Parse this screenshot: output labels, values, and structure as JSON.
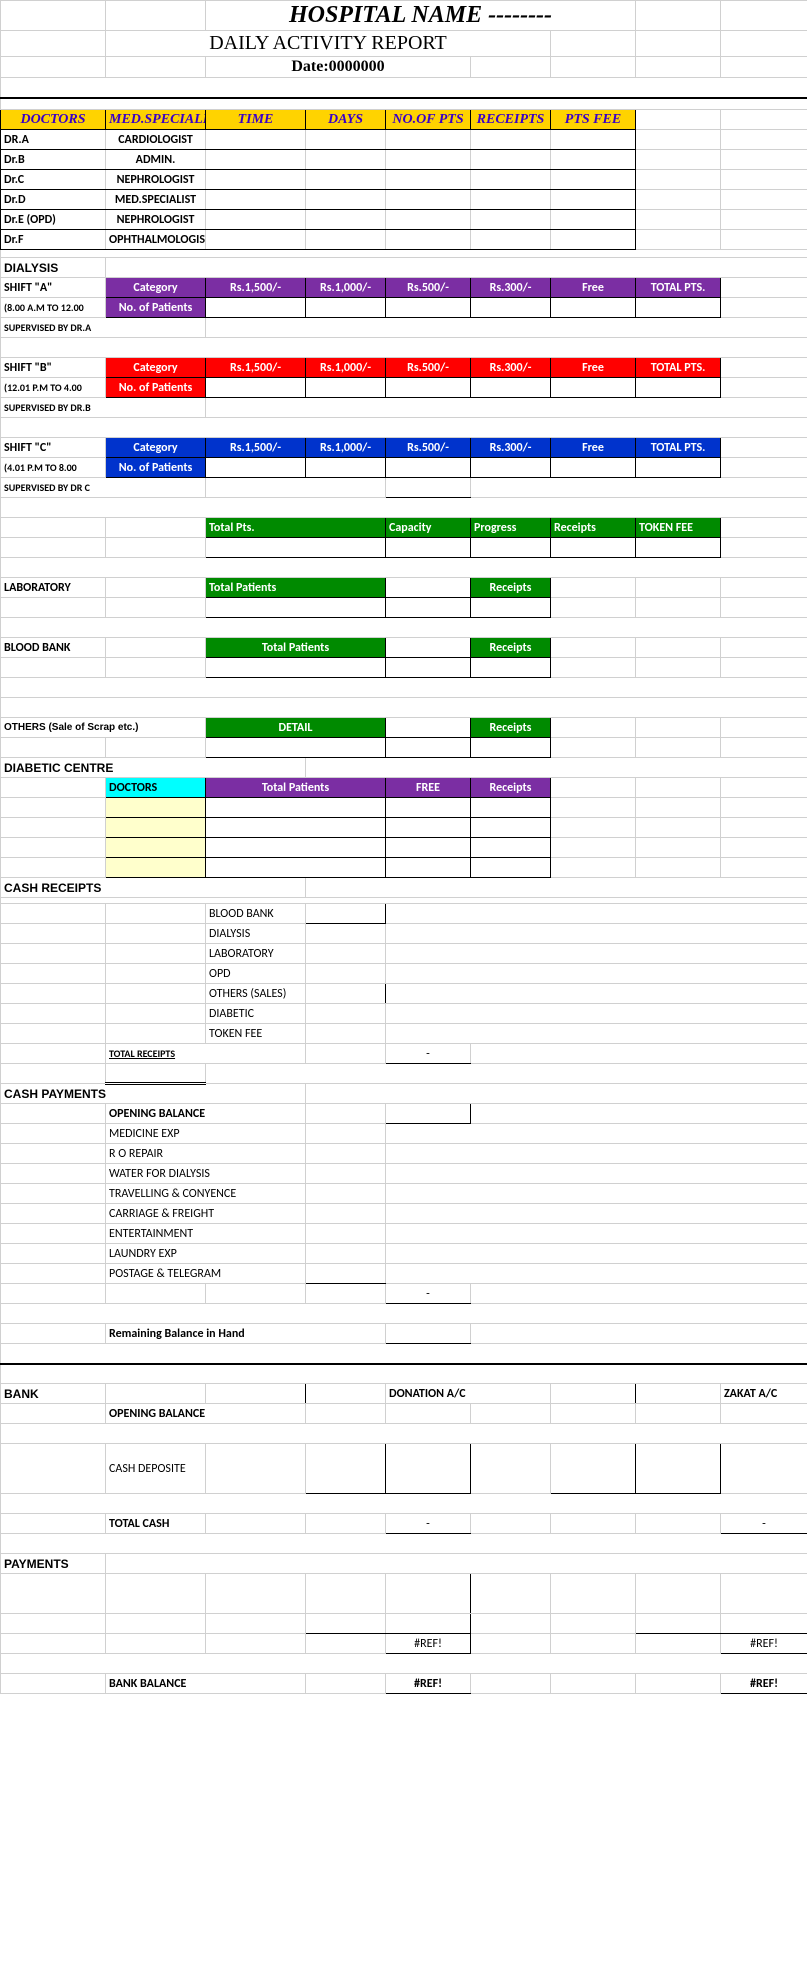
{
  "header": {
    "title": "HOSPITAL NAME --------",
    "subtitle": "DAILY ACTIVITY REPORT",
    "date": "Date:0000000"
  },
  "doctors_table": {
    "cols": [
      "DOCTORS",
      "MED.SPECIALIST",
      "TIME",
      "DAYS",
      "NO.OF PTS",
      "RECEIPTS",
      "PTS FEE"
    ],
    "rows": [
      {
        "dr": "DR.A",
        "spec": "CARDIOLOGIST"
      },
      {
        "dr": "Dr.B",
        "spec": "ADMIN."
      },
      {
        "dr": "Dr.C",
        "spec": "NEPHROLOGIST"
      },
      {
        "dr": "Dr.D",
        "spec": "MED.SPECIALIST"
      },
      {
        "dr": "Dr.E (OPD)",
        "spec": "NEPHROLOGIST"
      },
      {
        "dr": "Dr.F",
        "spec": "OPHTHALMOLOGIST"
      }
    ]
  },
  "dialysis": {
    "heading": "DIALYSIS",
    "shifts": [
      {
        "name": "SHIFT \"A\"",
        "time": "(8.00 A.M TO 12.00",
        "sup": "SUPERVISED BY DR.A",
        "color": "purple"
      },
      {
        "name": "SHIFT \"B\"",
        "time": "(12.01 P.M TO 4.00",
        "sup": "SUPERVISED BY DR.B",
        "color": "red"
      },
      {
        "name": "SHIFT \"C\"",
        "time": "(4.01 P.M TO 8.00",
        "sup": "SUPERVISED BY DR C",
        "color": "blue"
      }
    ],
    "cols": [
      "Category",
      "Rs.1,500/-",
      "Rs.1,000/-",
      "Rs.500/-",
      "Rs.300/-",
      "Free",
      "TOTAL PTS."
    ],
    "row2": "No. of Patients"
  },
  "summary": {
    "cols": [
      "Total Pts.",
      "Capacity",
      "Progress",
      "Receipts",
      "TOKEN FEE"
    ]
  },
  "lab": {
    "heading": "LABORATORY",
    "c1": "Total Patients",
    "c2": "Receipts"
  },
  "blood": {
    "heading": "BLOOD BANK",
    "c1": "Total Patients",
    "c2": "Receipts"
  },
  "others": {
    "heading": "OTHERS (Sale of Scrap etc.)",
    "c1": "DETAIL",
    "c2": "Receipts"
  },
  "diabetic": {
    "heading": "DIABETIC CENTRE",
    "doctors": "DOCTORS",
    "cols": [
      "Total Patients",
      "FREE",
      "Receipts"
    ]
  },
  "cash_receipts": {
    "heading": "CASH RECEIPTS",
    "items": [
      "BLOOD BANK",
      "DIALYSIS",
      "LABORATORY",
      "OPD",
      "OTHERS (SALES)",
      "DIABETIC",
      "TOKEN FEE"
    ],
    "total": "TOTAL RECEIPTS",
    "dash": "-"
  },
  "cash_payments": {
    "heading": "CASH PAYMENTS",
    "opening": "OPENING BALANCE",
    "items": [
      "MEDICINE EXP",
      " R O REPAIR",
      "WATER FOR DIALYSIS",
      "TRAVELLING & CONYENCE",
      "CARRIAGE & FREIGHT",
      "ENTERTAINMENT",
      "LAUNDRY EXP",
      "POSTAGE & TELEGRAM"
    ],
    "remaining": "Remaining Balance in Hand",
    "dash": "-"
  },
  "bank": {
    "heading": "BANK",
    "donation": "DONATION A/C",
    "zakat": "ZAKAT A/C",
    "opening": "OPENING BALANCE",
    "deposit": "CASH DEPOSITE",
    "totalcash": "TOTAL CASH",
    "dash": "-"
  },
  "payments": {
    "heading": "PAYMENTS",
    "ref": "#REF!",
    "balance": "BANK BALANCE"
  }
}
